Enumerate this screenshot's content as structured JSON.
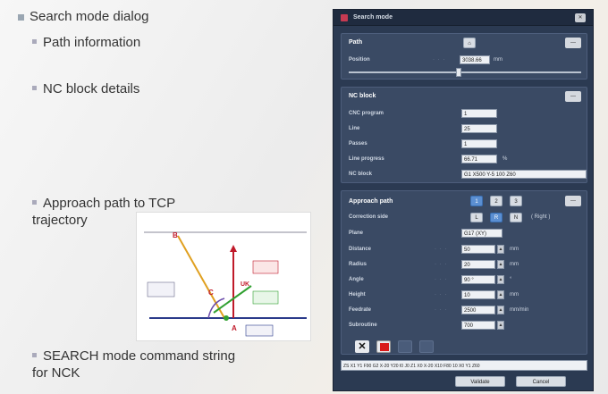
{
  "slide": {
    "bullets": [
      {
        "text": "Search mode dialog",
        "level": 1
      },
      {
        "text": "Path information",
        "level": 2
      },
      {
        "text": "NC block details",
        "level": 2
      },
      {
        "text": "Approach path to TCP trajectory",
        "level": 2
      },
      {
        "text": "SEARCH mode command string for NCK",
        "level": 2
      }
    ]
  },
  "diagram": {
    "labels": {
      "b": "B",
      "c": "C",
      "a": "A",
      "uk": "UK"
    }
  },
  "dialog": {
    "title": "Search mode",
    "path": {
      "heading": "Path",
      "position_label": "Position",
      "position_value": "3038.66",
      "position_unit": "mm",
      "slider_fraction": 0.46
    },
    "nc_block": {
      "heading": "NC block",
      "rows": [
        {
          "label": "CNC program",
          "value": "1"
        },
        {
          "label": "Line",
          "value": "25"
        },
        {
          "label": "Passes",
          "value": "1"
        },
        {
          "label": "Line progress",
          "value": "66.71",
          "unit": "%"
        },
        {
          "label": "NC block",
          "value": "G1 X500 Y-5 100 Z60"
        }
      ]
    },
    "approach": {
      "heading": "Approach path",
      "tab_labels": [
        "1",
        "2",
        "3"
      ],
      "correction_label": "Correction side",
      "correction_options": [
        "L",
        "R",
        "N"
      ],
      "correction_text": "( Right )",
      "plane_label": "Plane",
      "plane_value": "G17 (XY)",
      "rows": [
        {
          "label": "Distance",
          "value": "50",
          "unit": "mm"
        },
        {
          "label": "Radius",
          "value": "20",
          "unit": "mm"
        },
        {
          "label": "Angle",
          "value": "90 °",
          "unit": "°"
        },
        {
          "label": "Height",
          "value": "10",
          "unit": "mm"
        },
        {
          "label": "Feedrate",
          "value": "2500",
          "unit": "mm/min"
        },
        {
          "label": "Subroutine",
          "value": "700",
          "unit": ""
        }
      ]
    },
    "command_string": "ZS X1 Y1 F90 G2 X-20 Y20 I0 J0 Z1 X0 X-20 X10 F80 10 X0 Y1 Z60",
    "buttons": {
      "validate": "Validate",
      "cancel": "Cancel"
    },
    "colors": {
      "bg": "#2b3a52",
      "panel": "#3a4a64",
      "accent": "#5b8fd2",
      "stop": "#d91a1a"
    }
  }
}
